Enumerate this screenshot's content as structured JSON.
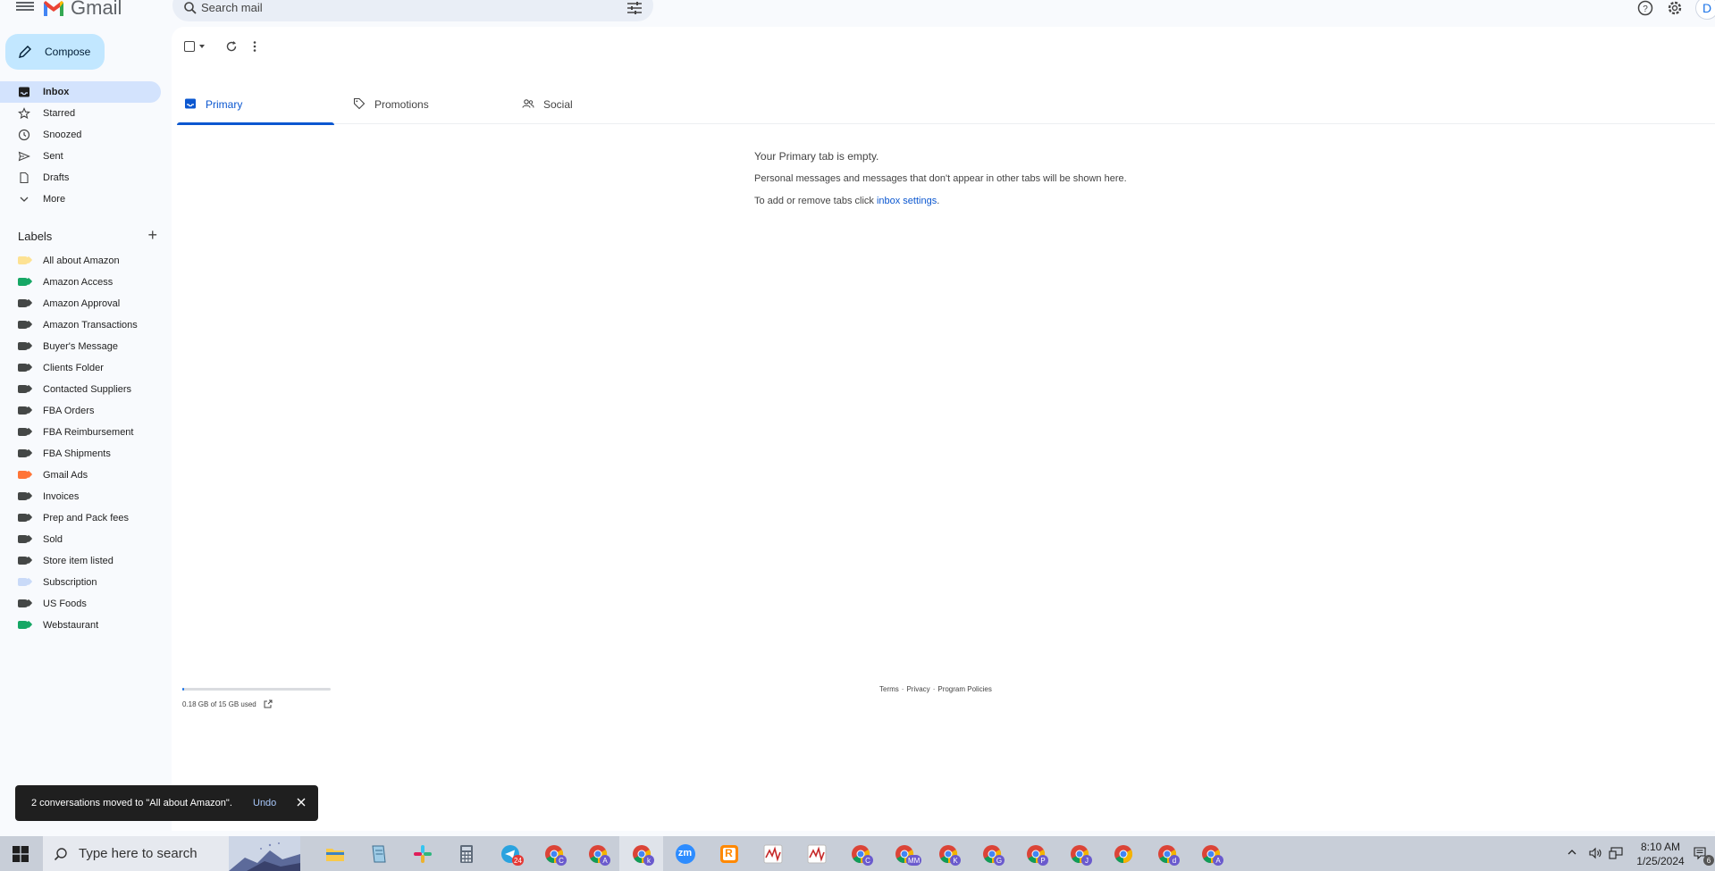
{
  "header": {
    "app_name": "Gmail",
    "search_placeholder": "Search mail",
    "avatar_letter": "D"
  },
  "compose_label": "Compose",
  "nav": {
    "items": [
      {
        "label": "Inbox",
        "icon": "inbox-icon",
        "active": true
      },
      {
        "label": "Starred",
        "icon": "star-icon"
      },
      {
        "label": "Snoozed",
        "icon": "clock-icon"
      },
      {
        "label": "Sent",
        "icon": "send-icon"
      },
      {
        "label": "Drafts",
        "icon": "draft-icon"
      },
      {
        "label": "More",
        "icon": "chevron-down-icon"
      }
    ]
  },
  "labels": {
    "title": "Labels",
    "add_symbol": "+",
    "items": [
      {
        "name": "All about Amazon",
        "color": "#fde293"
      },
      {
        "name": "Amazon Access",
        "color": "#16a765"
      },
      {
        "name": "Amazon Approval",
        "color": "#444746"
      },
      {
        "name": "Amazon Transactions",
        "color": "#444746"
      },
      {
        "name": "Buyer's Message",
        "color": "#444746"
      },
      {
        "name": "Clients Folder",
        "color": "#444746"
      },
      {
        "name": "Contacted Suppliers",
        "color": "#444746"
      },
      {
        "name": "FBA Orders",
        "color": "#444746"
      },
      {
        "name": "FBA Reimbursement",
        "color": "#444746"
      },
      {
        "name": "FBA Shipments",
        "color": "#444746"
      },
      {
        "name": "Gmail Ads",
        "color": "#ff7537"
      },
      {
        "name": "Invoices",
        "color": "#444746"
      },
      {
        "name": "Prep and Pack fees",
        "color": "#444746"
      },
      {
        "name": "Sold",
        "color": "#444746"
      },
      {
        "name": "Store item listed",
        "color": "#444746"
      },
      {
        "name": "Subscription",
        "color": "#c9daf8"
      },
      {
        "name": "US Foods",
        "color": "#444746"
      },
      {
        "name": "Webstaurant",
        "color": "#16a765"
      }
    ]
  },
  "tabs": [
    {
      "label": "Primary",
      "icon": "inbox-icon",
      "active": true
    },
    {
      "label": "Promotions",
      "icon": "tag-icon"
    },
    {
      "label": "Social",
      "icon": "people-icon"
    }
  ],
  "empty_state": {
    "title": "Your Primary tab is empty.",
    "body": "Personal messages and messages that don't appear in other tabs will be shown here.",
    "settings_prefix": "To add or remove tabs click ",
    "settings_link": "inbox settings",
    "settings_suffix": "."
  },
  "storage": {
    "text": "0.18 GB of 15 GB used",
    "fraction_used": 0.012
  },
  "footer": {
    "terms": "Terms",
    "separator": "·",
    "privacy": "Privacy",
    "policies": "Program Policies"
  },
  "snackbar": {
    "message": "2 conversations moved to \"All about Amazon\".",
    "undo": "Undo"
  },
  "taskbar": {
    "search_placeholder": "Type here to search",
    "time": "8:10 AM",
    "date": "1/25/2024",
    "notification_count": "6",
    "telegram_badge": "24",
    "apps": [
      {
        "name": "file-explorer-icon",
        "badge": ""
      },
      {
        "name": "notepad-icon",
        "badge": ""
      },
      {
        "name": "slack-icon",
        "badge": ""
      },
      {
        "name": "calculator-icon",
        "badge": ""
      },
      {
        "name": "telegram-icon",
        "badge": "24"
      },
      {
        "name": "chrome-icon",
        "badge": "C"
      },
      {
        "name": "chrome-icon",
        "badge": "A"
      },
      {
        "name": "chrome-icon",
        "badge": "k"
      },
      {
        "name": "zoom-icon",
        "badge": "zm"
      },
      {
        "name": "ringcentral-icon",
        "badge": "R"
      },
      {
        "name": "chart-app-icon",
        "badge": ""
      },
      {
        "name": "chart-app-icon",
        "badge": ""
      },
      {
        "name": "chrome-icon",
        "badge": "C"
      },
      {
        "name": "chrome-icon",
        "badge": "MM"
      },
      {
        "name": "chrome-icon",
        "badge": "K"
      },
      {
        "name": "chrome-icon",
        "badge": "G"
      },
      {
        "name": "chrome-icon",
        "badge": "P"
      },
      {
        "name": "chrome-icon",
        "badge": "J"
      },
      {
        "name": "chrome-icon",
        "badge": ""
      },
      {
        "name": "chrome-icon",
        "badge": "d"
      },
      {
        "name": "chrome-icon",
        "badge": "A"
      }
    ]
  }
}
